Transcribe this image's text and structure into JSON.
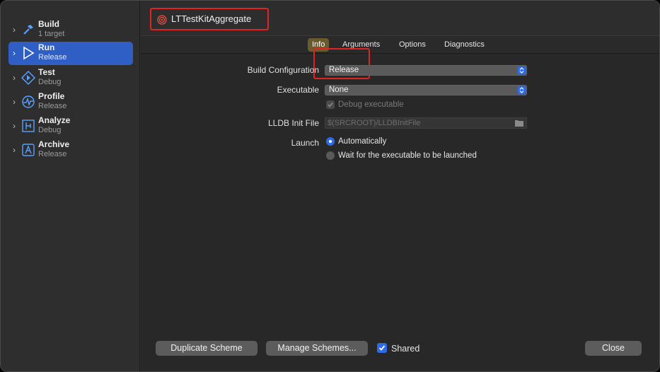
{
  "sidebar": {
    "items": [
      {
        "title": "Build",
        "subtitle": "1 target",
        "icon": "hammer-icon"
      },
      {
        "title": "Run",
        "subtitle": "Release",
        "icon": "play-icon",
        "selected": true
      },
      {
        "title": "Test",
        "subtitle": "Debug",
        "icon": "diamond-play-icon"
      },
      {
        "title": "Profile",
        "subtitle": "Release",
        "icon": "waveform-icon"
      },
      {
        "title": "Analyze",
        "subtitle": "Debug",
        "icon": "analyze-icon"
      },
      {
        "title": "Archive",
        "subtitle": "Release",
        "icon": "archive-icon"
      }
    ]
  },
  "scheme": {
    "name": "LTTestKitAggregate",
    "icon": "target-icon"
  },
  "tabs": [
    {
      "label": "Info",
      "active": true
    },
    {
      "label": "Arguments"
    },
    {
      "label": "Options"
    },
    {
      "label": "Diagnostics"
    }
  ],
  "form": {
    "build_configuration_label": "Build Configuration",
    "build_configuration_value": "Release",
    "executable_label": "Executable",
    "executable_value": "None",
    "debug_executable_label": "Debug executable",
    "lldb_label": "LLDB Init File",
    "lldb_placeholder": "$(SRCROOT)/LLDBInitFile",
    "launch_label": "Launch",
    "launch_options": [
      "Automatically",
      "Wait for the executable to be launched"
    ]
  },
  "footer": {
    "duplicate_label": "Duplicate Scheme",
    "manage_label": "Manage Schemes...",
    "shared_label": "Shared",
    "close_label": "Close"
  },
  "colors": {
    "accent": "#2e6be6",
    "selection": "#2f5fc4",
    "highlight": "#e02424",
    "active_tab": "#6b5a2c"
  }
}
